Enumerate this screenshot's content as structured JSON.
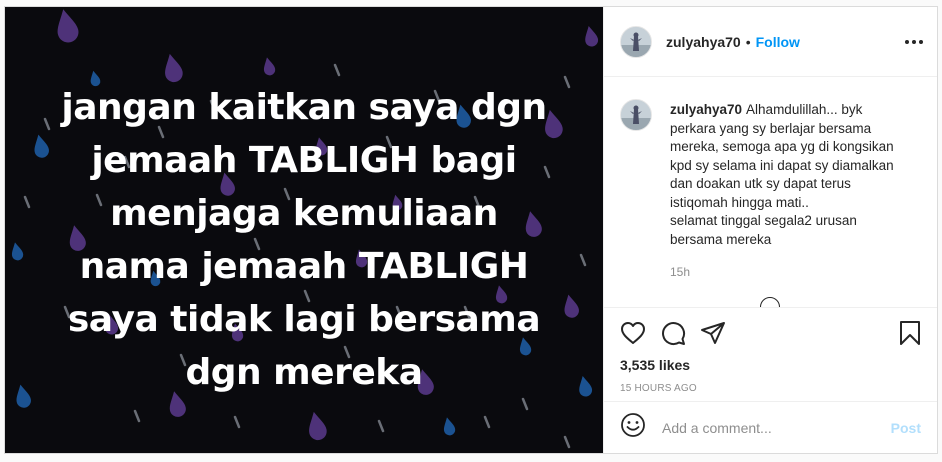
{
  "media": {
    "text_lines": [
      "jangan kaitkan saya dgn",
      "jemaah TABLIGH bagi",
      "menjaga kemuliaan",
      "nama jemaah TABLIGH",
      "saya tidak lagi bersama",
      "dgn mereka"
    ],
    "background_color": "#0a0a0e"
  },
  "header": {
    "username": "zulyahya70",
    "separator": "•",
    "follow_label": "Follow",
    "more_icon": "more-horizontal-icon"
  },
  "caption": {
    "username": "zulyahya70",
    "lines": [
      "Alhamdulillah... byk perkara yang sy berlajar bersama mereka, semoga apa yg di kongsikan kpd sy selama ini dapat sy diamalkan dan doakan utk sy dapat terus istiqomah hingga mati..",
      "selamat tinggal segala2 urusan bersama mereka"
    ],
    "time": "15h"
  },
  "actions": {
    "icons": [
      "heart-icon",
      "comment-icon",
      "share-icon",
      "bookmark-icon"
    ],
    "likes": "3,535 likes",
    "time_ago": "15 HOURS AGO"
  },
  "add_comment": {
    "placeholder": "Add a comment...",
    "post_label": "Post",
    "emoji_icon": "emoji-icon"
  },
  "colors": {
    "accent": "#0095f6",
    "post_disabled": "#b2dffc",
    "muted": "#8e8e8e",
    "drop_purple": "#5a3a8c",
    "drop_blue": "#1f5fa8"
  }
}
